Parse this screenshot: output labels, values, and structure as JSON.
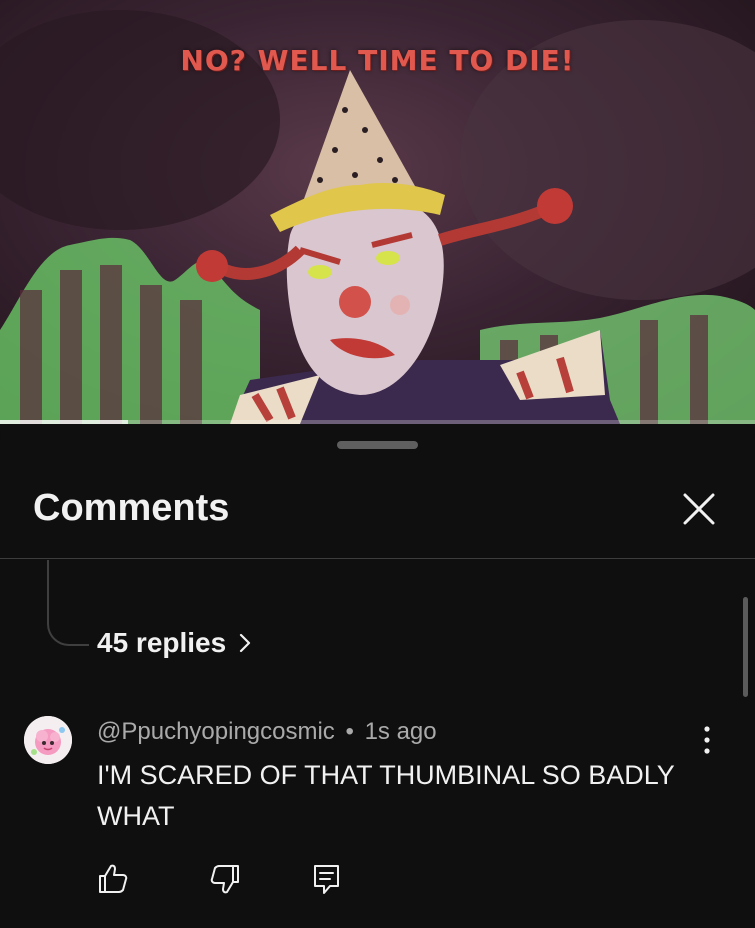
{
  "video": {
    "overlay_text": "NO? WELL TIME TO DIE!",
    "progress_fraction": 0.17
  },
  "sheet": {
    "title": "Comments",
    "close_icon": "close-icon"
  },
  "thread": {
    "replies_label": "45 replies",
    "chevron_icon": "chevron-right-icon"
  },
  "comment": {
    "author": "@Ppuchyopingcosmic",
    "separator": "•",
    "time": "1s ago",
    "text": "I'M SCARED OF THAT THUMBINAL SO BADLY WHAT",
    "more_icon": "more-vertical-icon",
    "actions": {
      "like_icon": "thumbs-up-icon",
      "dislike_icon": "thumbs-down-icon",
      "reply_icon": "reply-comment-icon"
    }
  },
  "colors": {
    "background": "#0f0f0f",
    "text_primary": "#f1f1f1",
    "text_secondary": "#aaaaaa",
    "overlay_text": "#e0584e",
    "visualizer_green": "#7ee07a"
  }
}
